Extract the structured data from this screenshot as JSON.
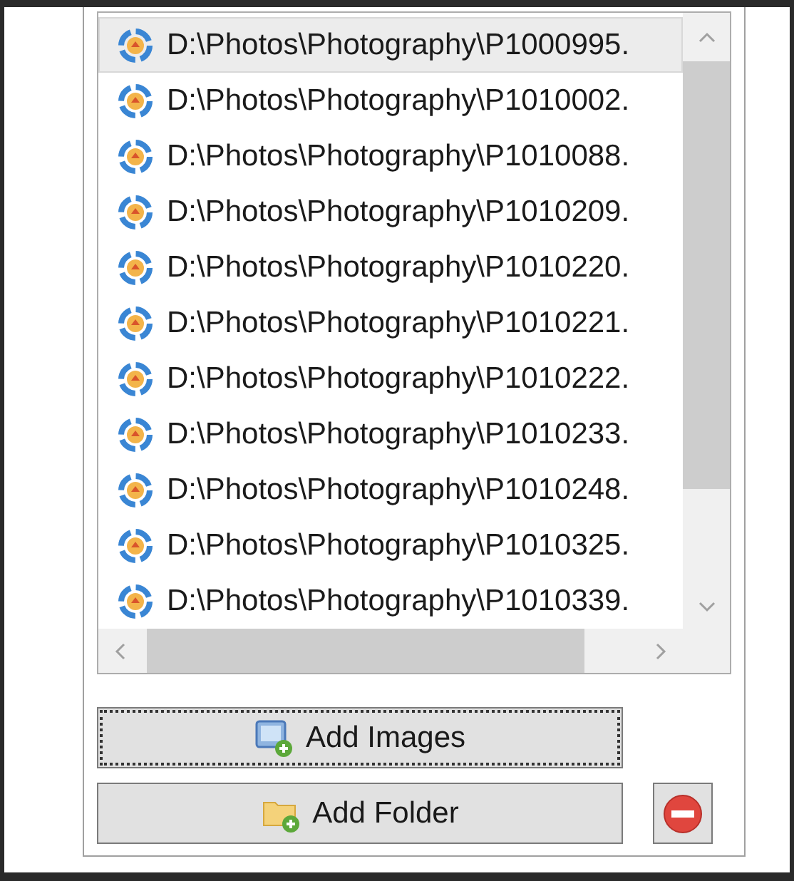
{
  "file_list": [
    {
      "path": "D:\\Photos\\Photography\\P1000995.",
      "selected": true
    },
    {
      "path": "D:\\Photos\\Photography\\P1010002.",
      "selected": false
    },
    {
      "path": "D:\\Photos\\Photography\\P1010088.",
      "selected": false
    },
    {
      "path": "D:\\Photos\\Photography\\P1010209.",
      "selected": false
    },
    {
      "path": "D:\\Photos\\Photography\\P1010220.",
      "selected": false
    },
    {
      "path": "D:\\Photos\\Photography\\P1010221.",
      "selected": false
    },
    {
      "path": "D:\\Photos\\Photography\\P1010222.",
      "selected": false
    },
    {
      "path": "D:\\Photos\\Photography\\P1010233.",
      "selected": false
    },
    {
      "path": "D:\\Photos\\Photography\\P1010248.",
      "selected": false
    },
    {
      "path": "D:\\Photos\\Photography\\P1010325.",
      "selected": false
    },
    {
      "path": "D:\\Photos\\Photography\\P1010339.",
      "selected": false
    }
  ],
  "buttons": [
    {
      "kind": "images",
      "label": "Add Images",
      "focused": true
    },
    {
      "kind": "folder",
      "label": "Add Folder",
      "focused": false
    }
  ]
}
